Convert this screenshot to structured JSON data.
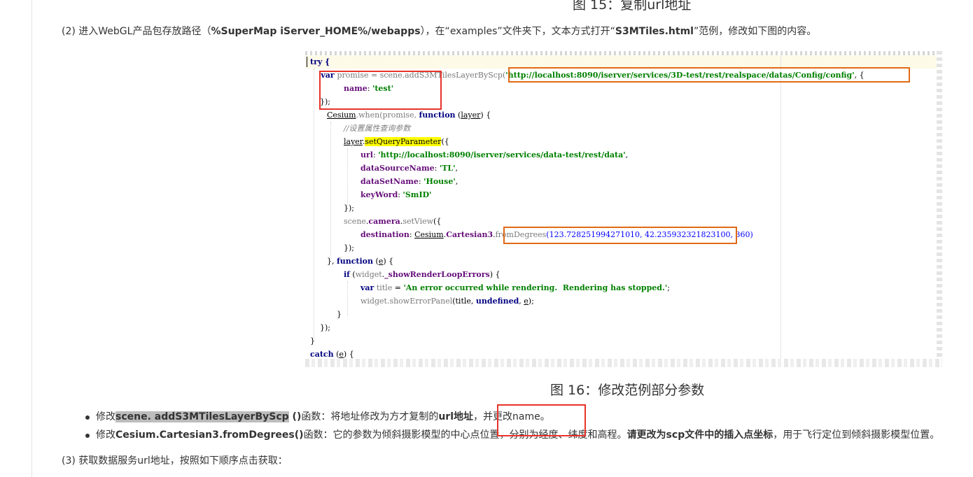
{
  "figure15_caption": "图 15：复制url地址",
  "step2": {
    "prefix": "(2) 进入WebGL产品包存放路径（",
    "path": "%SuperMap iServer_HOME%/webapps",
    "middle": "），在“examples”文件夹下，文本方式打开“",
    "file": "S3MTiles.html",
    "suffix": "”范例，修改如下图的内容。"
  },
  "code": {
    "line0": "try {",
    "line1_pre": "    var ",
    "line1_var": "promise",
    "line1_mid": " = scene.addS3MTilesLayerByScp(",
    "line1_url": "'http://localhost:8090/iserver/services/3D-test/rest/realspace/datas/Config/config'",
    "line1_end": ", {",
    "line2_prop": "name",
    "line2_val": "'test'",
    "line3": "    });",
    "line4_obj": "Cesium",
    "line4_mid": ".when(promise, ",
    "line4_kw": "function",
    "line4_arg": "layer",
    "line4_end": ") {",
    "line5": "//设置属性查询参数",
    "line6_obj": "layer",
    "line6_fn": "setQueryParameter",
    "line6_end": "({",
    "line7_prop": "url",
    "line7_val": "'http://localhost:8090/iserver/services/data-test/rest/data'",
    "line8_prop": "dataSourceName",
    "line8_val": "'TL'",
    "line9_prop": "dataSetName",
    "line9_val": "'House'",
    "line10_prop": "keyWord",
    "line10_val": "'SmID'",
    "line11": "});",
    "line12_obj": "scene",
    "line12_prop": "camera",
    "line12_fn": "setView",
    "line12_end": "({",
    "line13_prop": "destination",
    "line13_obj": "Cesium",
    "line13_cls": "Cartesian3",
    "line13_fn": "fromDegrees",
    "line13_args": "(123.728251994271010, 42.235932321823100, 360)",
    "line14": "});",
    "line15_kw": "function",
    "line15_arg": "e",
    "line16_kw": "if",
    "line16_obj": "widget",
    "line16_prop": "_showRenderLoopErrors",
    "line17_kw": "var",
    "line17_var": "title",
    "line17_val": "'An error occurred while rendering.  Rendering has stopped.'",
    "line18_fn": "widget.showErrorPanel",
    "line18_a": "title",
    "line18_kw": "undefined",
    "line18_arg": "e",
    "line19": "    }",
    "line20": "    });",
    "line21": "}",
    "line22_kw": "catch",
    "line22_arg": "e"
  },
  "figure16_caption": "图 16：修改范例部分参数",
  "bullets": {
    "b1_prefix": "修改",
    "b1_code": "scene. addS3MTilesLayerByScp",
    "b1_paren": " ()",
    "b1_mid": "函数：将地址修改为方才复制的",
    "b1_bold": "url地址",
    "b1_end": "，并更改name。",
    "b2_prefix": "修改",
    "b2_code": "Cesium.Cartesian3.fromDegrees()",
    "b2_mid": "函数：它的参数为倾斜摄影模型的中心点位置，分别为经度、纬度和高程。",
    "b2_bold": "请更改为scp文件中的插入点坐标",
    "b2_end": "，用于飞行定位到倾斜摄影模型位置。"
  },
  "step3": "(3) 获取数据服务url地址，按照如下顺序点击获取："
}
